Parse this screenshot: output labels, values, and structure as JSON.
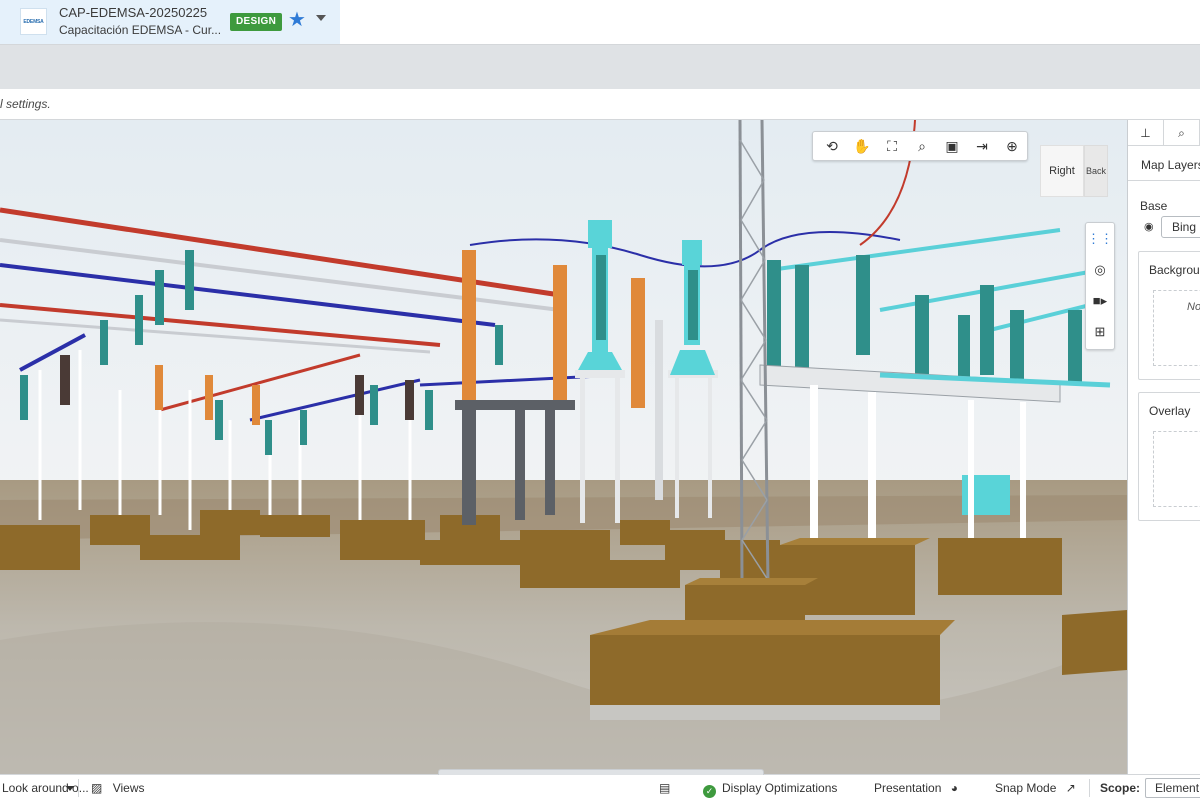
{
  "header": {
    "project_name": "CAP-EDEMSA-20250225",
    "project_subtitle": "Capacitación EDEMSA - Cur...",
    "badge": "DESIGN",
    "logo_text": "EDEMSA",
    "icons": {
      "favorite": "star-icon",
      "menu": "chevron-down-icon"
    },
    "colors": {
      "badge": "#3e9a3e",
      "star": "#2f7bd6",
      "card": "#e5f1fb"
    }
  },
  "message_bar": {
    "text": "l settings."
  },
  "viewport": {
    "nav_toolbar": [
      "orbit-icon",
      "pan-hand-icon",
      "fit-view-icon",
      "zoom-window-icon",
      "toggle-camera-icon",
      "window-area-icon",
      "globe-icon"
    ],
    "view_cube": {
      "right": "Right",
      "back": "Back"
    },
    "side_tools": [
      "walk-icon",
      "look-around-icon",
      "camera-icon",
      "measure-icon"
    ]
  },
  "right_panel": {
    "tabs": [
      "tree-icon",
      "search-icon"
    ],
    "title": "Map Layers",
    "base_label": "Base",
    "base_value": "Bing",
    "background_label": "Background",
    "background_empty": "No",
    "overlay_label": "Overlay"
  },
  "status_bar": {
    "left_tool": "Look around o...",
    "views": "Views",
    "display_optimizations": "Display Optimizations",
    "presentation": "Presentation",
    "snap_mode": "Snap Mode",
    "scope_label": "Scope:",
    "scope_value": "Element"
  }
}
